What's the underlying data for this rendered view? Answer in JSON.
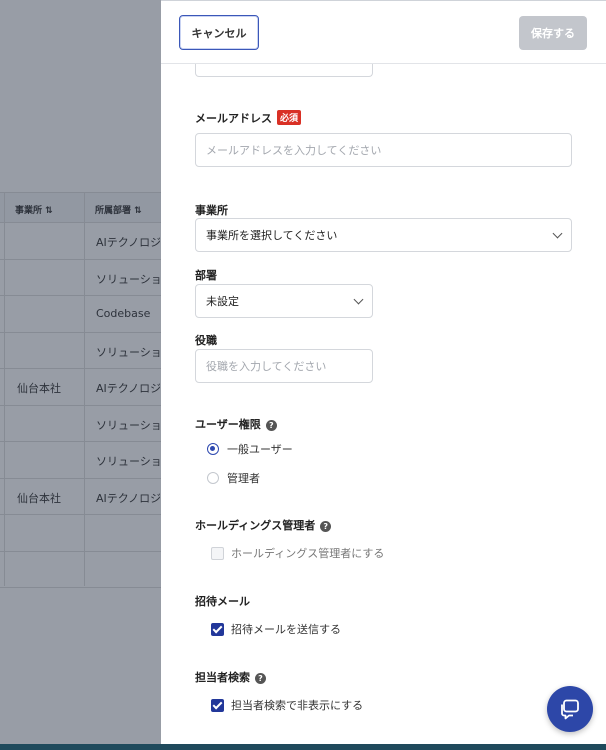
{
  "background_table": {
    "headers": {
      "office": "事業所 ⇅",
      "department": "所属部署 ⇅"
    },
    "rows": [
      {
        "office": "",
        "department": "AIテクノロジ"
      },
      {
        "office": "",
        "department": "ソリューショ"
      },
      {
        "office": "",
        "department": "Codebase"
      },
      {
        "office": "",
        "department": "ソリューショ"
      },
      {
        "office": "仙台本社",
        "department": "AIテクノロジ"
      },
      {
        "office": "",
        "department": "ソリューショ"
      },
      {
        "office": "",
        "department": "ソリューショ"
      },
      {
        "office": "仙台本社",
        "department": "AIテクノロジ"
      },
      {
        "office": "",
        "department": ""
      },
      {
        "office": "",
        "department": ""
      }
    ]
  },
  "header": {
    "cancel_label": "キャンセル",
    "save_label": "保存する"
  },
  "form": {
    "email": {
      "label": "メールアドレス",
      "required_badge": "必須",
      "placeholder": "メールアドレスを入力してください",
      "value": ""
    },
    "office": {
      "label": "事業所",
      "selected": "事業所を選択してください"
    },
    "department": {
      "label": "部署",
      "selected": "未設定"
    },
    "position": {
      "label": "役職",
      "placeholder": "役職を入力してください",
      "value": ""
    },
    "user_role": {
      "label": "ユーザー権限",
      "help_icon": "?",
      "options": [
        {
          "label": "一般ユーザー",
          "selected": true
        },
        {
          "label": "管理者",
          "selected": false
        }
      ]
    },
    "holdings_admin": {
      "label": "ホールディングス管理者",
      "help_icon": "?",
      "checkbox_label": "ホールディングス管理者にする",
      "checked": false,
      "disabled": true
    },
    "invite_mail": {
      "label": "招待メール",
      "checkbox_label": "招待メールを送信する",
      "checked": true
    },
    "staff_search": {
      "label": "担当者検索",
      "help_icon": "?",
      "checkbox_label": "担当者検索で非表示にする",
      "checked": true
    }
  },
  "icons": {
    "chat": "chat-bubble-icon",
    "select_arrow": "chevron-down-icon",
    "sort": "sort-icon"
  },
  "colors": {
    "primary": "#2d47a8",
    "required": "#d93025",
    "save_disabled": "#c3c6cc"
  }
}
